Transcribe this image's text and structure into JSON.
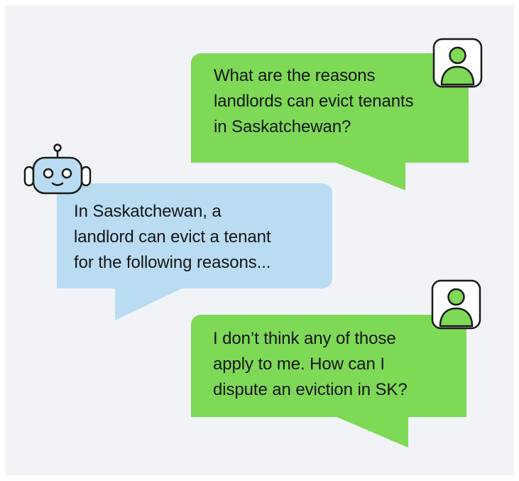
{
  "colors": {
    "user_bubble": "#7ed957",
    "bot_bubble": "#b9dcf3",
    "panel_background": "#f2f3f7",
    "avatar_stroke": "#1a1a1a",
    "bot_face": "#b9dcf3"
  },
  "conversation": {
    "messages": [
      {
        "sender": "user",
        "avatar_icon": "user-avatar-icon",
        "text": "What are the reasons\nlandlords can evict tenants\nin Saskatchewan?"
      },
      {
        "sender": "bot",
        "avatar_icon": "robot-avatar-icon",
        "text": "In Saskatchewan, a\nlandlord can evict a tenant\nfor the following reasons..."
      },
      {
        "sender": "user",
        "avatar_icon": "user-avatar-icon",
        "text": "I don’t think any of those\napply to me. How can I\ndispute an eviction in SK?"
      }
    ]
  }
}
